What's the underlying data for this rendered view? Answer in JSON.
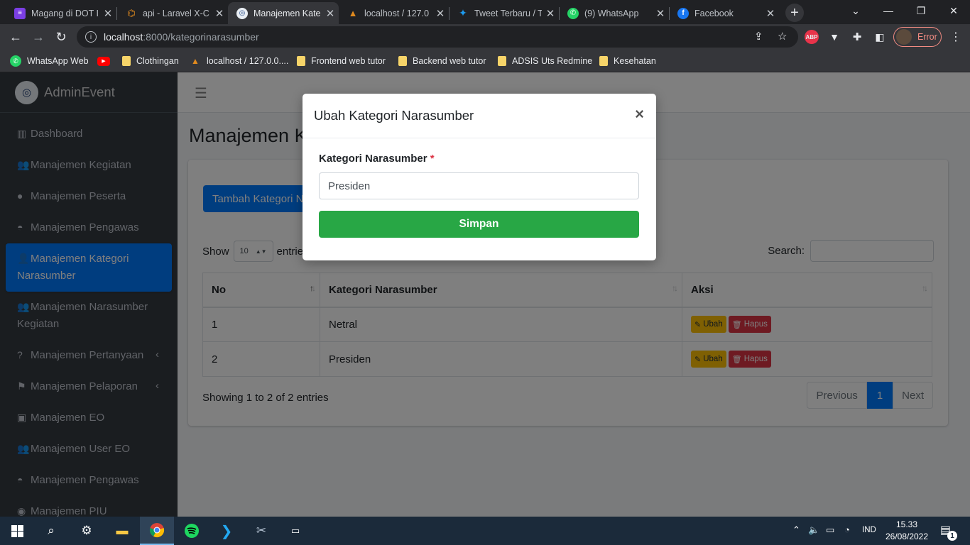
{
  "browser": {
    "tabs": [
      {
        "title": "Magang di DOT I",
        "fav": "≡",
        "color": "#7b3fe4"
      },
      {
        "title": "api - Laravel X-C",
        "fav": "⌘",
        "color": "#6b4f2e"
      },
      {
        "title": "Manajemen Kate",
        "fav": "◎",
        "color": "#2c4f8a"
      },
      {
        "title": "localhost / 127.0",
        "fav": "▲",
        "color": "#e08a1e"
      },
      {
        "title": "Tweet Terbaru / T",
        "fav": "✦",
        "color": "#1d9bf0"
      },
      {
        "title": "(9) WhatsApp",
        "fav": "✆",
        "color": "#25d366"
      },
      {
        "title": "Facebook",
        "fav": "f",
        "color": "#1877f2"
      }
    ],
    "url_host": "localhost",
    "url_path": ":8000/kategorinarasumber",
    "profile_label": "Error",
    "bookmarks": [
      {
        "label": "WhatsApp Web",
        "kind": "whatsapp"
      },
      {
        "label": "",
        "kind": "youtube"
      },
      {
        "label": "Clothingan",
        "kind": "folder"
      },
      {
        "label": "localhost / 127.0.0....",
        "kind": "pma"
      },
      {
        "label": "Frontend web tutor",
        "kind": "folder"
      },
      {
        "label": "Backend web tutor",
        "kind": "folder"
      },
      {
        "label": "ADSIS Uts Redmine",
        "kind": "folder"
      },
      {
        "label": "Kesehatan",
        "kind": "folder"
      }
    ]
  },
  "brand": {
    "name": "AdminEvent"
  },
  "sidebar": {
    "items": [
      {
        "label": "Dashboard",
        "icon": "▥"
      },
      {
        "label": "Manajemen Kegiatan",
        "icon": "👥"
      },
      {
        "label": "Manajemen Peserta",
        "icon": "●"
      },
      {
        "label": "Manajemen Pengawas",
        "icon": "◓"
      },
      {
        "label": "Manajemen Kategori Narasumber",
        "icon": "👤"
      },
      {
        "label": "Manajemen Narasumber Kegiatan",
        "icon": "👥"
      },
      {
        "label": "Manajemen Pertanyaan",
        "icon": "?"
      },
      {
        "label": "Manajemen Pelaporan",
        "icon": "⚑"
      },
      {
        "label": "Manajemen EO",
        "icon": "▣"
      },
      {
        "label": "Manajemen User EO",
        "icon": "👥"
      },
      {
        "label": "Manajemen Pengawas",
        "icon": "◓"
      },
      {
        "label": "Manajemen PIU",
        "icon": "◉"
      }
    ]
  },
  "page": {
    "title": "Manajemen Kategori Narasumber",
    "add_button": "Tambah Kategori Narasumber",
    "show_label": "Show",
    "show_value": "10",
    "entries_label": "entries",
    "search_label": "Search:",
    "columns": [
      "No",
      "Kategori Narasumber",
      "Aksi"
    ],
    "rows": [
      {
        "no": "1",
        "kategori": "Netral"
      },
      {
        "no": "2",
        "kategori": "Presiden"
      }
    ],
    "edit_label": "Ubah",
    "delete_label": "Hapus",
    "info": "Showing 1 to 2 of 2 entries",
    "pagination": {
      "previous": "Previous",
      "current": "1",
      "next": "Next"
    }
  },
  "modal": {
    "title": "Ubah Kategori Narasumber",
    "close": "×",
    "field_label": "Kategori Narasumber",
    "required_mark": "*",
    "field_value": "Presiden",
    "save_label": "Simpan"
  },
  "taskbar": {
    "lang": "IND",
    "time": "15.33",
    "date": "26/08/2022",
    "notification_count": "1"
  }
}
